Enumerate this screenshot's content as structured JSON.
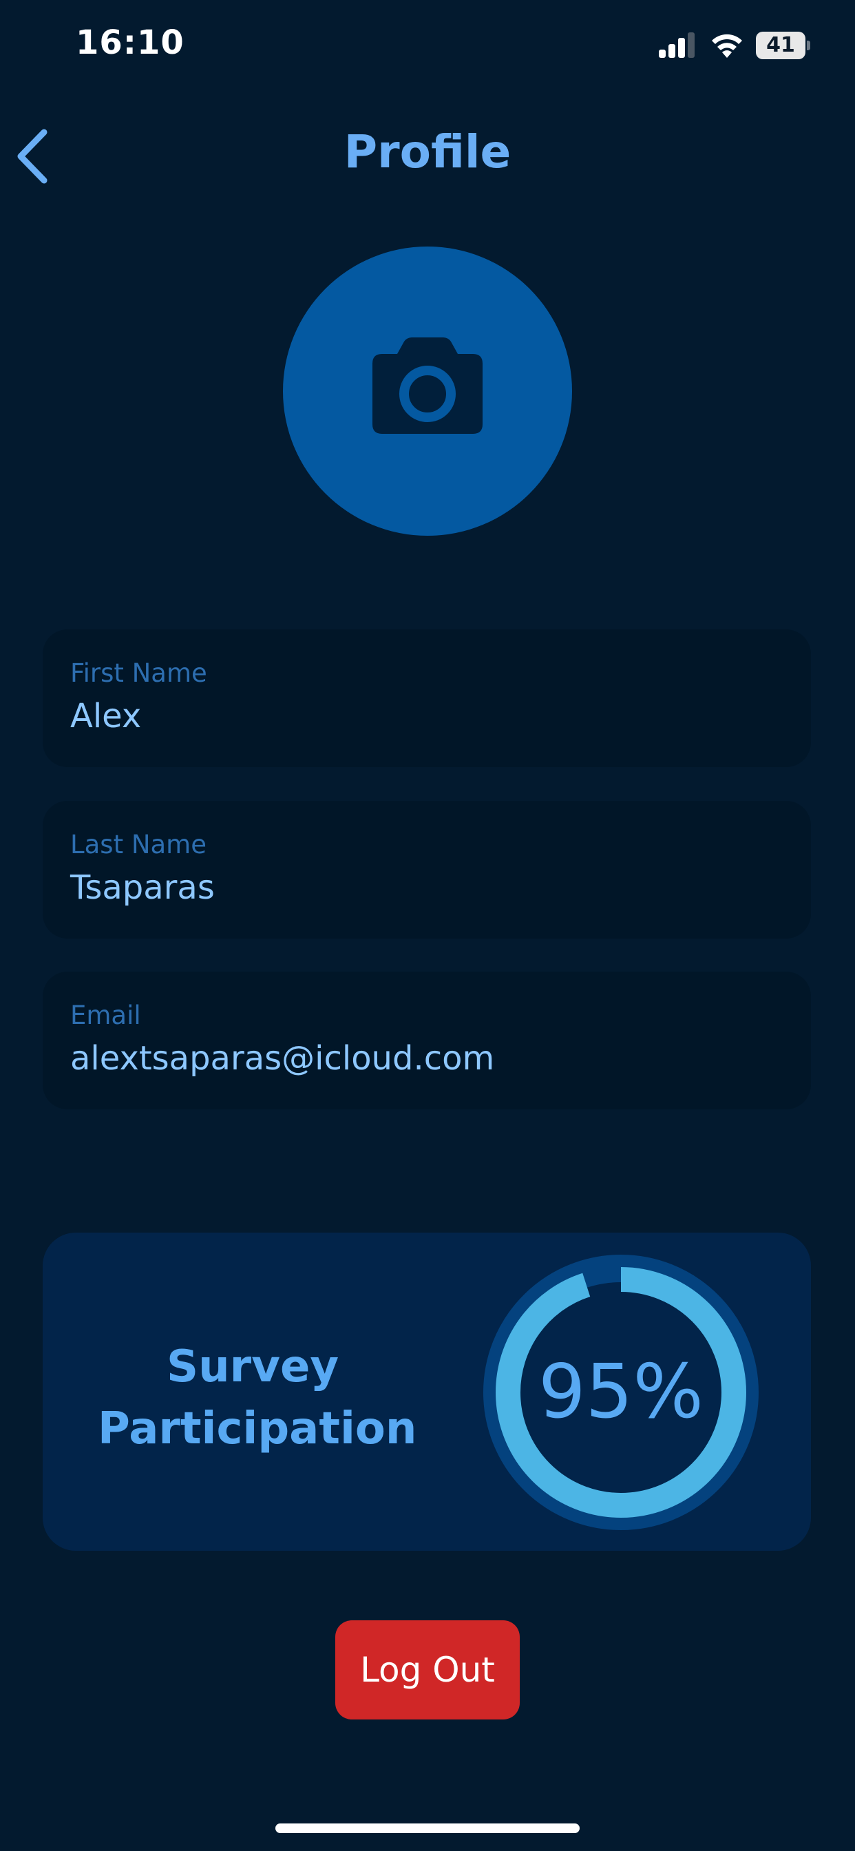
{
  "status_bar": {
    "time": "16:10",
    "battery": "41",
    "icons": [
      "signal-icon",
      "wifi-icon",
      "battery-icon"
    ]
  },
  "header": {
    "title": "Profile",
    "back_icon": "chevron-left-icon"
  },
  "avatar": {
    "icon": "camera-icon"
  },
  "fields": {
    "first_name": {
      "label": "First Name",
      "value": "Alex"
    },
    "last_name": {
      "label": "Last Name",
      "value": "Tsaparas"
    },
    "email": {
      "label": "Email",
      "value": "alextsaparas@icloud.com"
    }
  },
  "survey": {
    "title_line1": "Survey",
    "title_line2": "Participation",
    "percent_label": "95%",
    "fraction": 0.95
  },
  "logout": {
    "label": "Log Out"
  },
  "colors": {
    "background": "#031a2f",
    "accent": "#6aaef5",
    "avatar": "#0459a1",
    "field_bg": "#011628",
    "card_bg": "#02244a",
    "ring_track": "#04427e",
    "ring_fill": "#4cb5e5",
    "logout": "#d02727"
  }
}
